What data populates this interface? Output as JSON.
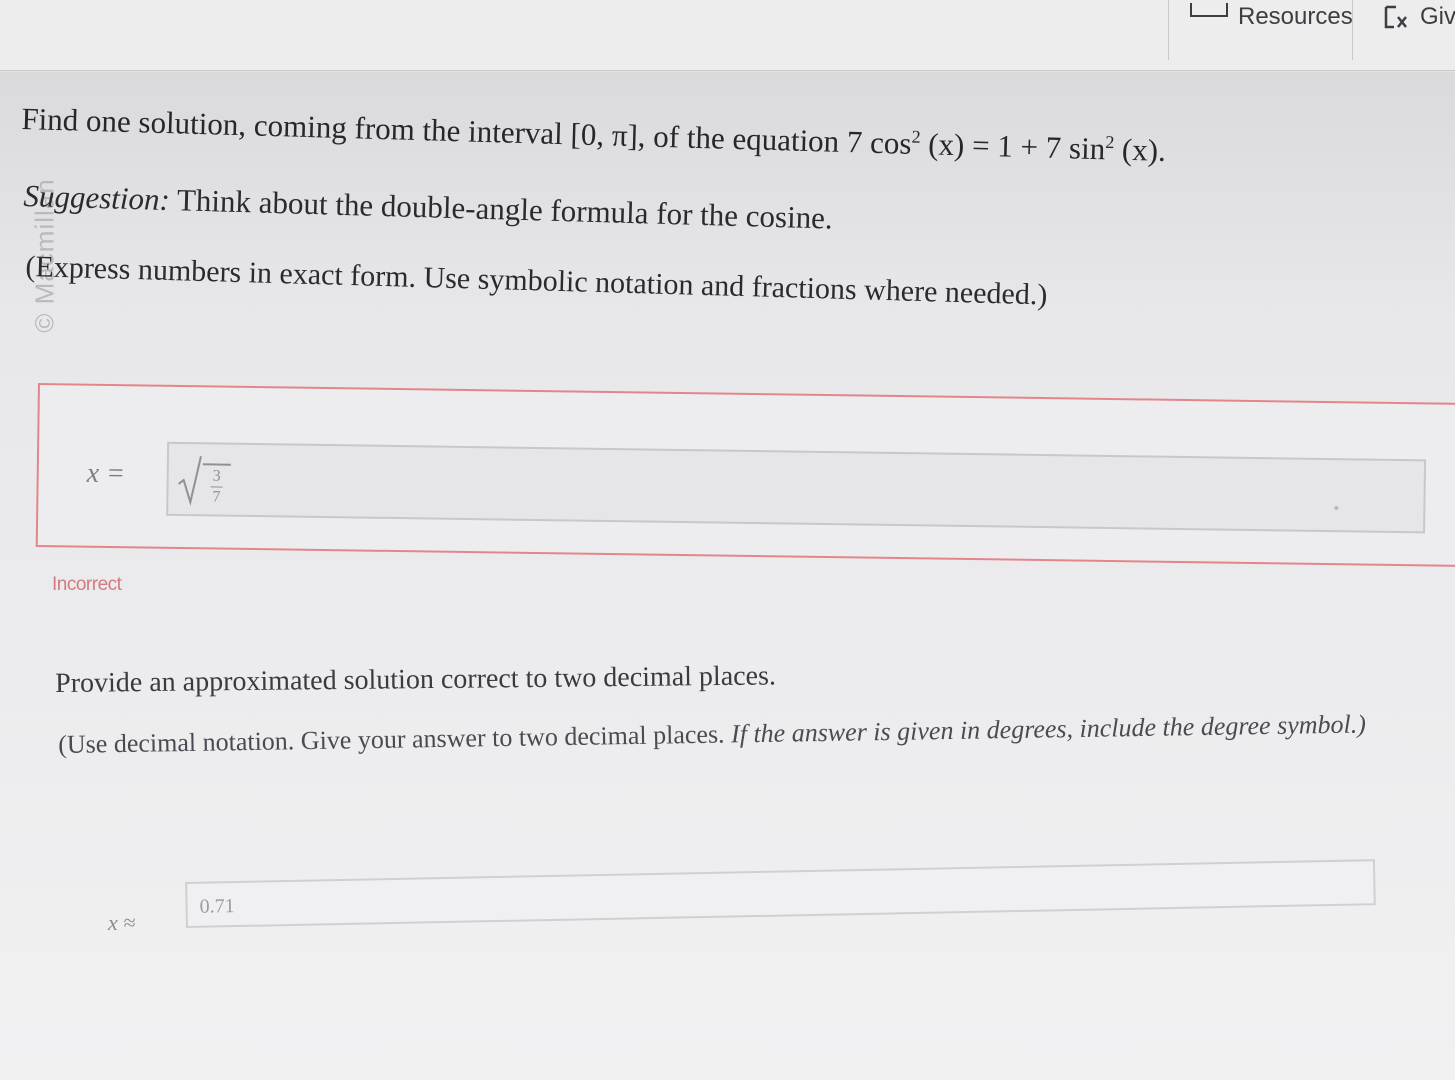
{
  "toolbar": {
    "resources_label": "Resources",
    "give_label": "Giv"
  },
  "sidebar": {
    "watermark": "© Macmillan"
  },
  "question": {
    "text_prefix": "Find one solution, coming from the interval [0, π], of the equation 7 cos",
    "exp1": "2",
    "mid": " (x) = 1 + 7 sin",
    "exp2": "2",
    "suffix": " (x).",
    "suggestion_label": "Suggestion:",
    "suggestion_text": " Think about the double-angle formula for the cosine.",
    "express_note": "(Express numbers in exact form. Use symbolic notation and fractions where needed.)"
  },
  "answer1": {
    "variable_label": "x =",
    "numerator": "3",
    "denominator": "7",
    "status": "Incorrect"
  },
  "part2": {
    "prompt": "Provide an approximated solution correct to two decimal places.",
    "note_part1": "(Use decimal notation. Give your answer to two decimal places.",
    "note_part2": " If the answer is given in degrees, include the degree symbol.)"
  },
  "answer2": {
    "variable_label": "x ≈",
    "value": "0.71"
  },
  "colors": {
    "incorrect": "#d47a7f",
    "frame_border": "#e3868c"
  }
}
